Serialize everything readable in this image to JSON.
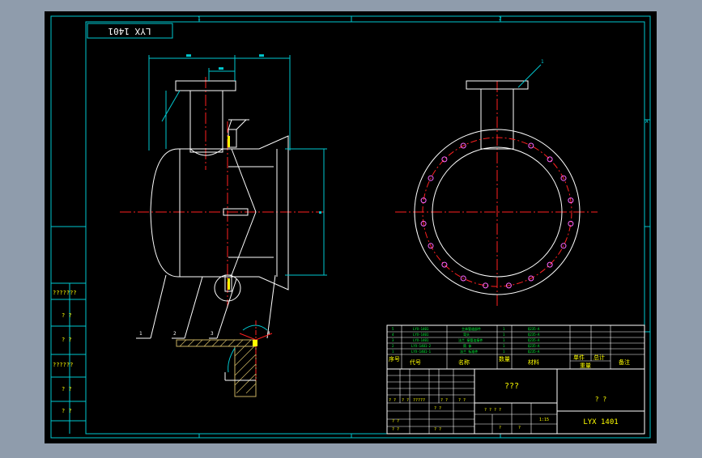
{
  "viewport": {
    "background": "#8f9cac",
    "sheet_background": "#000000"
  },
  "colors": {
    "frame": "#00c8d0",
    "white": "#ffffff",
    "center_line": "#ff2020",
    "yellow": "#ffff00",
    "green": "#00ff3c",
    "hatch": "#c8b060"
  },
  "drawing": {
    "stamp_text": "LYX 1401",
    "zone_letters": [
      "1",
      "2",
      "A"
    ],
    "part_number_flange": "1",
    "callouts": [
      "1",
      "2",
      "3",
      "4"
    ]
  },
  "parts_list": {
    "header": {
      "index": "序号",
      "code": "代号",
      "name": "名称",
      "qty": "数量",
      "material": "材料",
      "unit_weight": "单件",
      "total_weight": "总计",
      "weight": "重量",
      "remark": "备注"
    },
    "rows": [
      {
        "index": "5",
        "code": "LYX-1401",
        "name": "主体管道部件",
        "qty": "1",
        "material": "Q235-A",
        "weight": "",
        "remark": ""
      },
      {
        "index": "4",
        "code": "LYX-1401",
        "name": "弯头",
        "qty": "1",
        "material": "Q235-A",
        "weight": "",
        "remark": ""
      },
      {
        "index": "3",
        "code": "LYX-1401",
        "name": "法兰 接管连接件",
        "qty": "1",
        "material": "Q235-A",
        "weight": "",
        "remark": ""
      },
      {
        "index": "2",
        "code": "LYX-1401-2",
        "name": "筒 体",
        "qty": "1",
        "material": "Q235-A",
        "weight": "",
        "remark": ""
      },
      {
        "index": "1",
        "code": "LYX-1401-1",
        "name": "法兰 标准件",
        "qty": "1",
        "material": "Q235-A",
        "weight": "",
        "remark": ""
      }
    ]
  },
  "title_block": {
    "title": "???",
    "company": "? ?",
    "drawing_no": "LYX 1401",
    "scale": "1:15",
    "stage_label": "? ? ? ?"
  },
  "left_strip": {
    "labels": [
      "???????",
      "? ?",
      "? ?",
      "??????",
      "? ?",
      "? ?"
    ]
  }
}
